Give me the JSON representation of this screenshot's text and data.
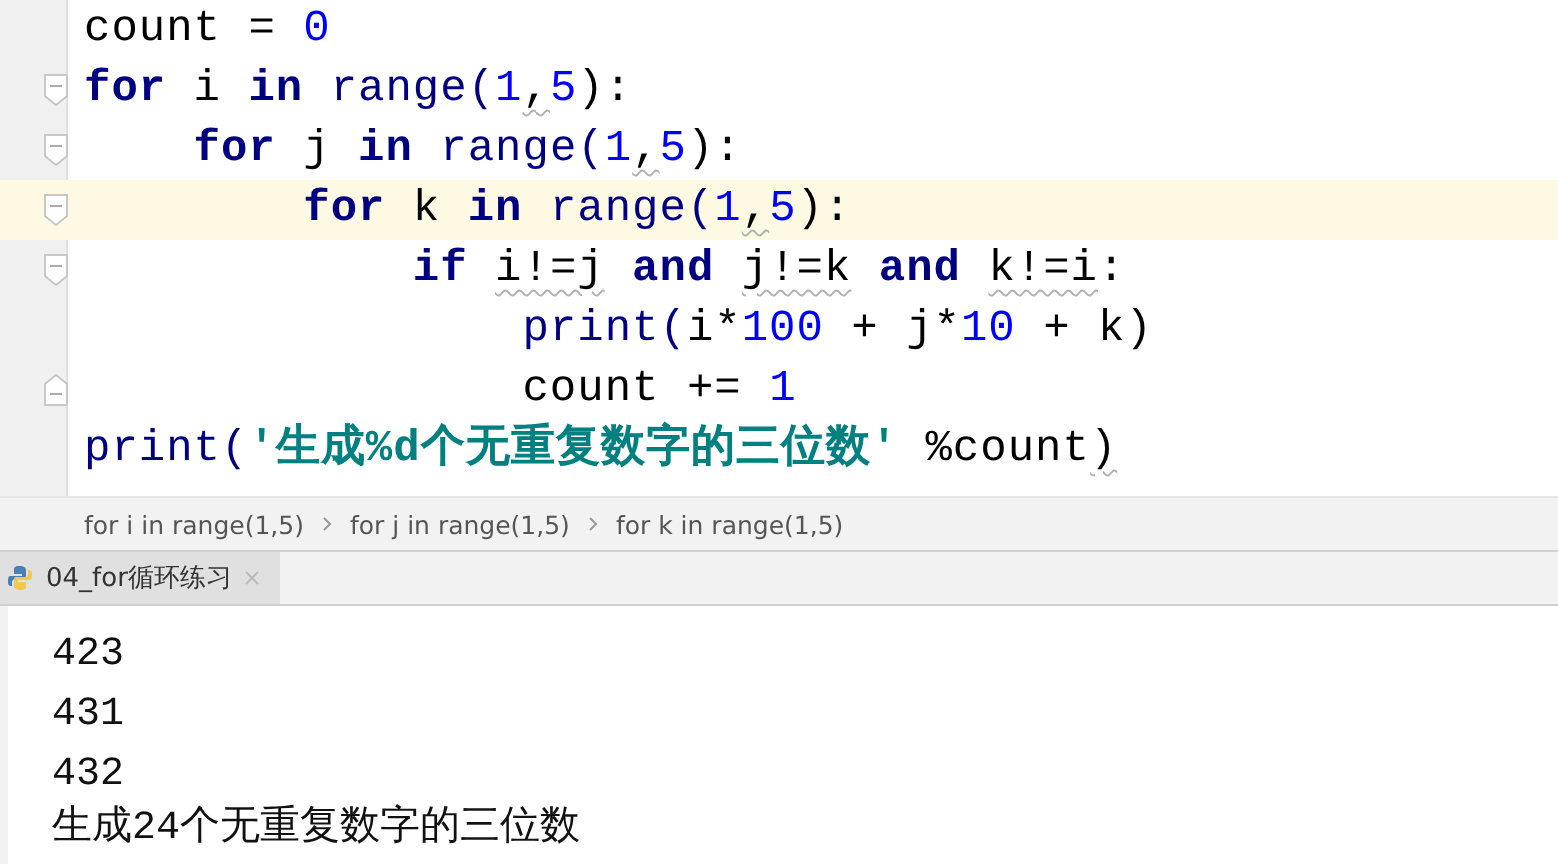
{
  "editor": {
    "lines": [
      {
        "current": false,
        "tokens": [
          {
            "text": "count = ",
            "kind": "plain"
          },
          {
            "text": "0",
            "kind": "number"
          }
        ]
      },
      {
        "fold_start": true,
        "current": false,
        "tokens": [
          {
            "text": "for",
            "kind": "keyword"
          },
          {
            "text": " i ",
            "kind": "plain"
          },
          {
            "text": "in",
            "kind": "keyword"
          },
          {
            "text": " range(",
            "kind": "builtin"
          },
          {
            "text": "1",
            "kind": "number"
          },
          {
            "text": ",",
            "kind": "plain",
            "warning": true
          },
          {
            "text": "5",
            "kind": "number"
          },
          {
            "text": "):",
            "kind": "plain"
          }
        ]
      },
      {
        "fold_start": true,
        "current": false,
        "tokens": [
          {
            "text": "    for",
            "kind": "keyword"
          },
          {
            "text": " j ",
            "kind": "plain"
          },
          {
            "text": "in",
            "kind": "keyword"
          },
          {
            "text": " range(",
            "kind": "builtin"
          },
          {
            "text": "1",
            "kind": "number"
          },
          {
            "text": ",",
            "kind": "plain",
            "warning": true
          },
          {
            "text": "5",
            "kind": "number"
          },
          {
            "text": "):",
            "kind": "plain"
          }
        ]
      },
      {
        "fold_start": true,
        "current": true,
        "tokens": [
          {
            "text": "        for",
            "kind": "keyword"
          },
          {
            "text": " k ",
            "kind": "plain"
          },
          {
            "text": "in",
            "kind": "keyword"
          },
          {
            "text": " range(",
            "kind": "builtin"
          },
          {
            "text": "1",
            "kind": "number"
          },
          {
            "text": ",",
            "kind": "plain",
            "warning": true
          },
          {
            "text": "5",
            "kind": "number"
          },
          {
            "text": "):",
            "kind": "plain"
          }
        ]
      },
      {
        "fold_start": true,
        "current": false,
        "tokens": [
          {
            "text": "            if ",
            "kind": "keyword"
          },
          {
            "text": "i!=j",
            "kind": "plain",
            "warning": true
          },
          {
            "text": " and ",
            "kind": "keyword"
          },
          {
            "text": "j!=k",
            "kind": "plain",
            "warning": true
          },
          {
            "text": " and ",
            "kind": "keyword"
          },
          {
            "text": "k!=i",
            "kind": "plain",
            "warning": true
          },
          {
            "text": ":",
            "kind": "plain"
          }
        ]
      },
      {
        "current": false,
        "tokens": [
          {
            "text": "                print(",
            "kind": "builtin"
          },
          {
            "text": "i*",
            "kind": "plain"
          },
          {
            "text": "100",
            "kind": "number"
          },
          {
            "text": " + j*",
            "kind": "plain"
          },
          {
            "text": "10",
            "kind": "number"
          },
          {
            "text": " + k)",
            "kind": "plain"
          }
        ]
      },
      {
        "fold_end": true,
        "current": false,
        "tokens": [
          {
            "text": "                count += ",
            "kind": "plain"
          },
          {
            "text": "1",
            "kind": "number"
          }
        ]
      },
      {
        "current": false,
        "tokens": [
          {
            "text": "print(",
            "kind": "builtin"
          },
          {
            "text": "'生成%d个无重复数字的三位数'",
            "kind": "string"
          },
          {
            "text": " %count",
            "kind": "plain"
          },
          {
            "text": ")",
            "kind": "plain",
            "warning": true
          }
        ]
      }
    ]
  },
  "breadcrumbs": [
    "for i in range(1,5)",
    "for j in range(1,5)",
    "for k in range(1,5)"
  ],
  "run_tabs": [
    {
      "label": "04_for循环练习",
      "selected": true
    }
  ],
  "console": [
    "423",
    "431",
    "432",
    "生成24个无重复数字的三位数"
  ]
}
